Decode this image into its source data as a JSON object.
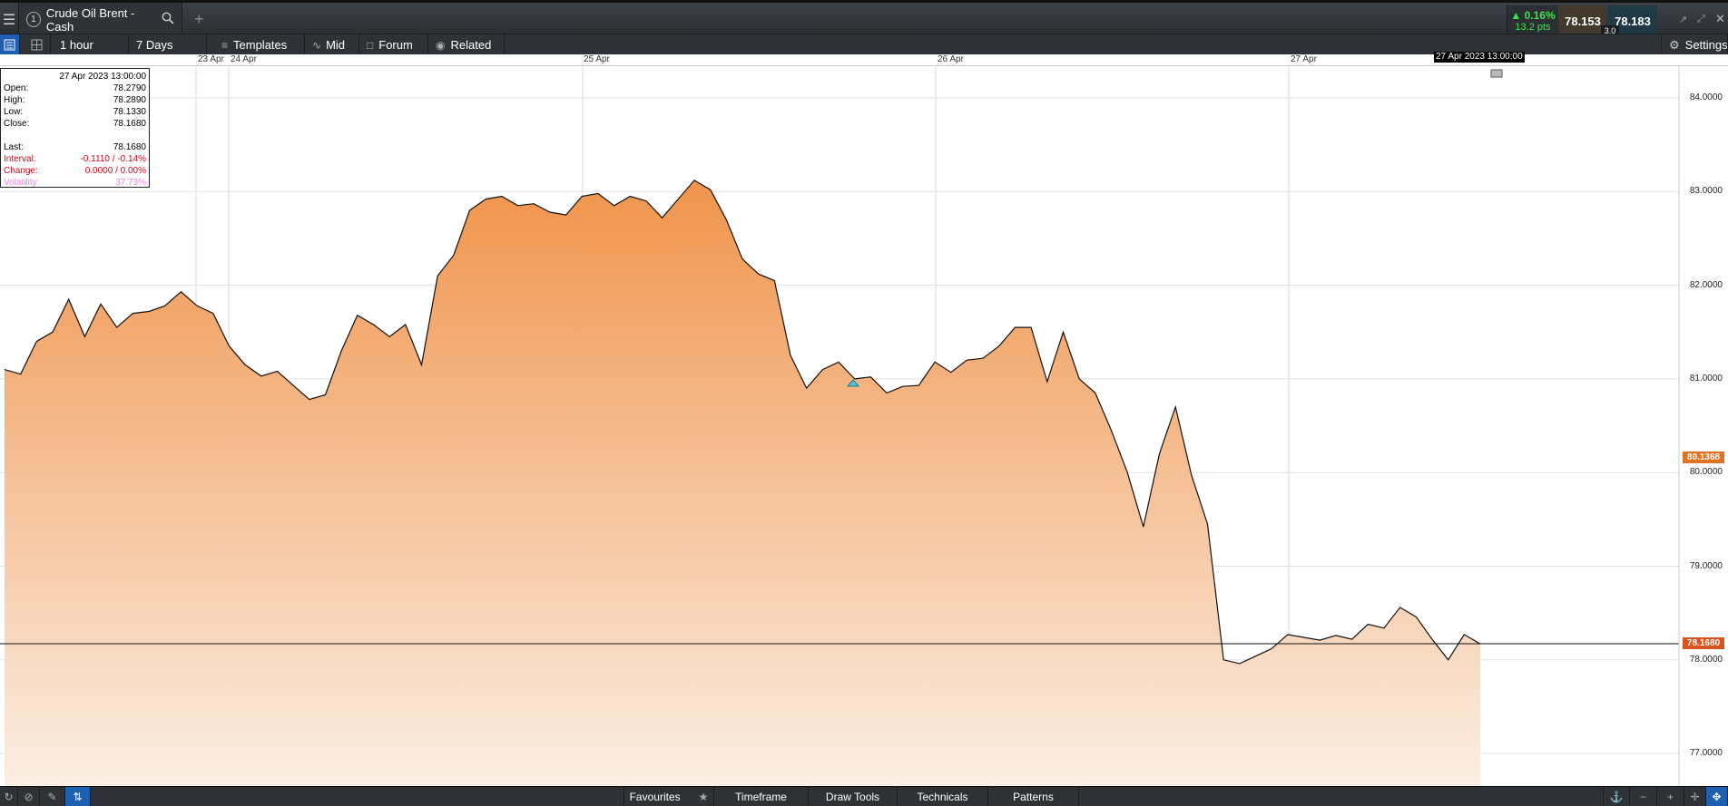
{
  "tab": {
    "number": "1",
    "title": "Crude Oil Brent - Cash"
  },
  "quote": {
    "change_pct": "▲ 0.16%",
    "change_pts": "13.2 pts",
    "sell": "78.153",
    "buy": "78.183",
    "spread": "3.0"
  },
  "toolbar": {
    "interval": "1 hour",
    "range": "7 Days",
    "templates": "Templates",
    "mid": "Mid",
    "forum": "Forum",
    "related": "Related",
    "settings": "Settings"
  },
  "axis_dates": [
    "23 Apr",
    "24 Apr",
    "25 Apr",
    "26 Apr",
    "27 Apr"
  ],
  "cursor_label": "27 Apr 2023 13:00:00",
  "ohlc": {
    "date": "27 Apr 2023 13:00:00",
    "open_label": "Open:",
    "open": "78.2790",
    "high_label": "High:",
    "high": "78.2890",
    "low_label": "Low:",
    "low": "78.1330",
    "close_label": "Close:",
    "close": "78.1680",
    "last_label": "Last:",
    "last": "78.1680",
    "interval_label": "Interval:",
    "interval": "-0.1110 / -0.14%",
    "change_label": "Change:",
    "change": "0.0000 / 0.00%",
    "volatility_label": "Volatility:",
    "volatility": "37.73%"
  },
  "price_ticks": [
    "84.0000",
    "83.0000",
    "82.0000",
    "81.0000",
    "80.0000",
    "79.0000",
    "78.0000",
    "77.0000"
  ],
  "current_price": "78.1680",
  "marker_price": "80.1368",
  "bottom": {
    "favourites": "Favourites",
    "timeframe": "Timeframe",
    "draw_tools": "Draw Tools",
    "technicals": "Technicals",
    "patterns": "Patterns"
  },
  "colors": {
    "accent_orange": "#f0934a",
    "current_tag": "#d9531e",
    "marker_tag": "#e07322"
  },
  "chart_data": {
    "type": "area",
    "ylim": [
      76.8,
      84.4
    ],
    "y": [
      81.1,
      81.05,
      81.4,
      81.5,
      81.85,
      81.45,
      81.8,
      81.55,
      81.7,
      81.72,
      81.78,
      81.93,
      81.78,
      81.7,
      81.35,
      81.15,
      81.03,
      81.08,
      80.93,
      80.78,
      80.83,
      81.3,
      81.68,
      81.58,
      81.45,
      81.58,
      81.15,
      82.1,
      82.32,
      82.8,
      82.92,
      82.95,
      82.85,
      82.87,
      82.78,
      82.75,
      82.95,
      82.98,
      82.85,
      82.95,
      82.9,
      82.72,
      82.92,
      83.12,
      83.02,
      82.7,
      82.28,
      82.12,
      82.05,
      81.25,
      80.9,
      81.1,
      81.18,
      81.0,
      81.02,
      80.85,
      80.92,
      80.93,
      81.18,
      81.07,
      81.2,
      81.22,
      81.35,
      81.55,
      81.55,
      80.97,
      81.5,
      81.0,
      80.85,
      80.45,
      80.0,
      79.42,
      80.2,
      80.7,
      79.97,
      79.45,
      78.0,
      77.96,
      78.04,
      78.12,
      78.27,
      78.24,
      78.21,
      78.26,
      78.22,
      78.38,
      78.34,
      78.56,
      78.46,
      78.22,
      78.0,
      78.27,
      78.17
    ]
  }
}
